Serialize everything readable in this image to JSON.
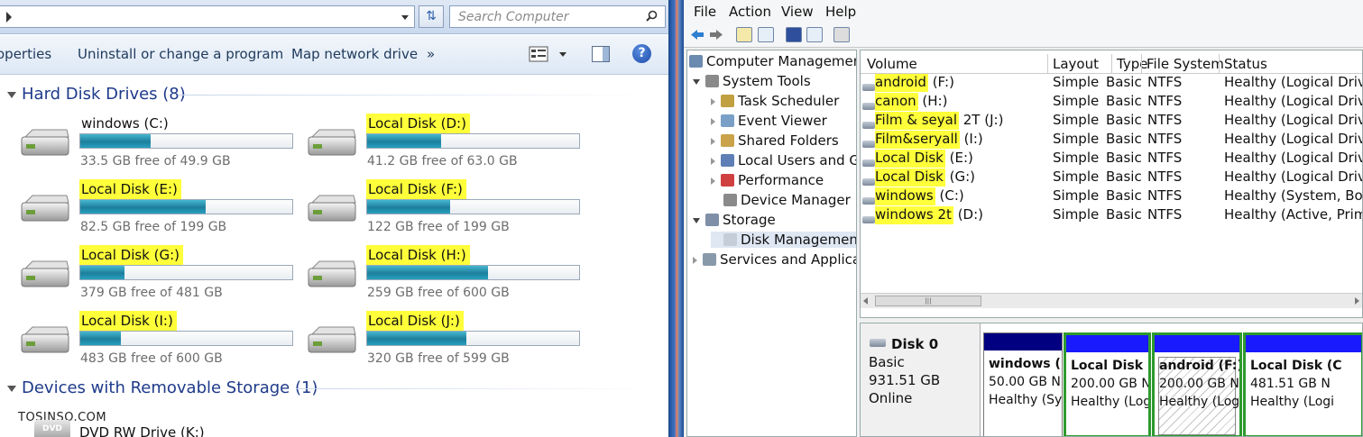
{
  "explorer": {
    "search_placeholder": "Search Computer",
    "toolbar": {
      "properties": "operties",
      "uninstall": "Uninstall or change a program",
      "map_drive": "Map network drive",
      "more": "»"
    },
    "hard_disk_group": "Hard Disk Drives (8)",
    "drives": [
      {
        "name": "windows (C:)",
        "free": "33.5 GB free of 49.9 GB",
        "used": 0.33,
        "highlight": false
      },
      {
        "name": "Local Disk (D:)",
        "free": "41.2 GB free of 63.0 GB",
        "used": 0.35,
        "highlight": true
      },
      {
        "name": "Local Disk (E:)",
        "free": "82.5 GB free of 199 GB",
        "used": 0.59,
        "highlight": true
      },
      {
        "name": "Local Disk (F:)",
        "free": "122 GB free of 199 GB",
        "used": 0.39,
        "highlight": true
      },
      {
        "name": "Local Disk (G:)",
        "free": "379 GB free of 481 GB",
        "used": 0.21,
        "highlight": true
      },
      {
        "name": "Local Disk (H:)",
        "free": "259 GB free of 600 GB",
        "used": 0.57,
        "highlight": true
      },
      {
        "name": "Local Disk (I:)",
        "free": "483 GB free of 600 GB",
        "used": 0.19,
        "highlight": true
      },
      {
        "name": "Local Disk (J:)",
        "free": "320 GB free of 599 GB",
        "used": 0.47,
        "highlight": true
      }
    ],
    "removable_group": "Devices with Removable Storage (1)",
    "dvd_drive": "DVD RW Drive (K:)",
    "watermark": "TOSINSO.COM"
  },
  "cm": {
    "menu": [
      "File",
      "Action",
      "View",
      "Help"
    ],
    "tree": [
      {
        "label": "Computer Management",
        "level": 0,
        "exp": "none"
      },
      {
        "label": "System Tools",
        "level": 1,
        "exp": "open"
      },
      {
        "label": "Task Scheduler",
        "level": 2,
        "exp": "closed"
      },
      {
        "label": "Event Viewer",
        "level": 2,
        "exp": "closed"
      },
      {
        "label": "Shared Folders",
        "level": 2,
        "exp": "closed"
      },
      {
        "label": "Local Users and Gr",
        "level": 2,
        "exp": "closed"
      },
      {
        "label": "Performance",
        "level": 2,
        "exp": "closed"
      },
      {
        "label": "Device Manager",
        "level": 2,
        "exp": "none"
      },
      {
        "label": "Storage",
        "level": 1,
        "exp": "open"
      },
      {
        "label": "Disk Management",
        "level": 2,
        "exp": "none"
      },
      {
        "label": "Services and Applicat",
        "level": 1,
        "exp": "closed"
      }
    ],
    "columns": [
      "Volume",
      "Layout",
      "Type",
      "File System",
      "Status"
    ],
    "volumes": [
      {
        "name": "android",
        "suffix": " (F:)",
        "layout": "Simple",
        "type": "Basic",
        "fs": "NTFS",
        "status": "Healthy (Logical Drive"
      },
      {
        "name": "canon",
        "suffix": " (H:)",
        "layout": "Simple",
        "type": "Basic",
        "fs": "NTFS",
        "status": "Healthy (Logical Drive"
      },
      {
        "name": "Film & seyal",
        "suffix": " 2T (J:)",
        "layout": "Simple",
        "type": "Basic",
        "fs": "NTFS",
        "status": "Healthy (Logical Drive"
      },
      {
        "name": "Film&seryall",
        "suffix": " (I:)",
        "layout": "Simple",
        "type": "Basic",
        "fs": "NTFS",
        "status": "Healthy (Logical Drive"
      },
      {
        "name": "Local Disk",
        "suffix": " (E:)",
        "layout": "Simple",
        "type": "Basic",
        "fs": "NTFS",
        "status": "Healthy (Logical Drive"
      },
      {
        "name": "Local Disk",
        "suffix": " (G:)",
        "layout": "Simple",
        "type": "Basic",
        "fs": "NTFS",
        "status": "Healthy (Logical Drive"
      },
      {
        "name": "windows",
        "suffix": " (C:)",
        "layout": "Simple",
        "type": "Basic",
        "fs": "NTFS",
        "status": "Healthy (System, Boot,"
      },
      {
        "name": "windows 2t",
        "suffix": " (D:)",
        "layout": "Simple",
        "type": "Basic",
        "fs": "NTFS",
        "status": "Healthy (Active, Primar"
      }
    ],
    "disk": {
      "name": "Disk 0",
      "type": "Basic",
      "size": "931.51 GB",
      "state": "Online"
    },
    "partitions": [
      {
        "title": "windows (",
        "size": "50.00 GB N",
        "status": "Healthy (Sy",
        "hatch": false,
        "green": false,
        "bar": "#000080"
      },
      {
        "title": "Local Disk (",
        "size": "200.00 GB N",
        "status": "Healthy (Log",
        "hatch": false,
        "green": true,
        "bar": "#1a1aff"
      },
      {
        "title": "android  (F:)",
        "size": "200.00 GB NT",
        "status": "Healthy (Log",
        "hatch": true,
        "green": true,
        "bar": "#1a1aff"
      },
      {
        "title": "Local Disk  (C",
        "size": "481.51 GB N",
        "status": "Healthy (Logi",
        "hatch": false,
        "green": true,
        "bar": "#1a1aff"
      }
    ],
    "colors": {
      "highlight": "#ffff3a",
      "primary_bar": "#000080",
      "logical_bar": "#1a1aff",
      "extended_border": "#2e9a2e"
    }
  }
}
